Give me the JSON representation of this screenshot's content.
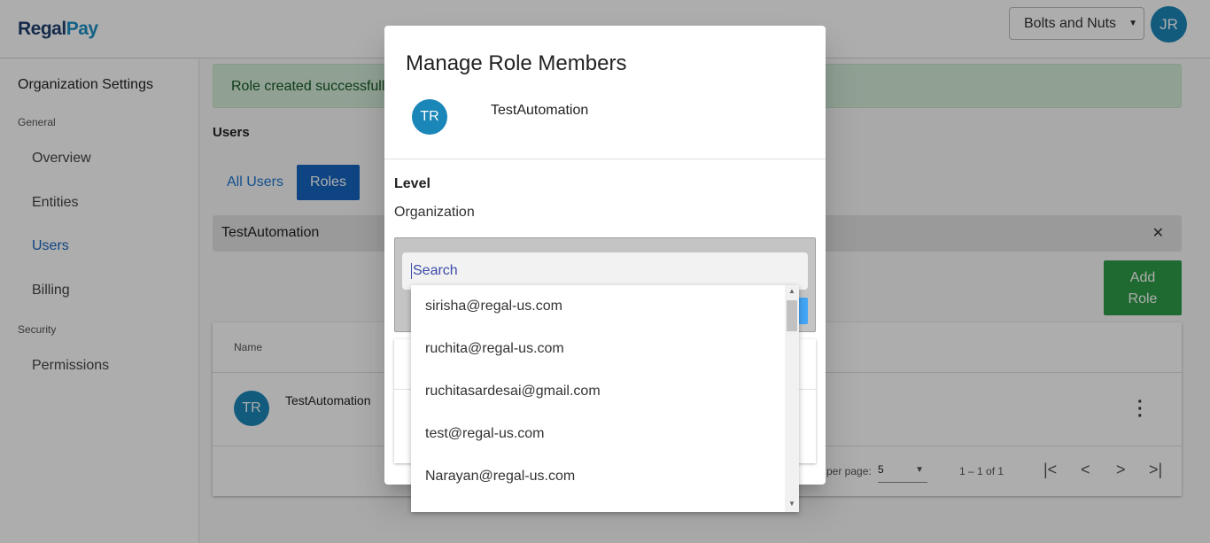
{
  "header": {
    "logo_part1": "Regal",
    "logo_part2": "Pay",
    "org_select": "Bolts and Nuts",
    "user_initials": "JR"
  },
  "sidebar": {
    "title": "Organization Settings",
    "sections": [
      {
        "label": "General",
        "items": [
          "Overview",
          "Entities",
          "Users",
          "Billing"
        ]
      },
      {
        "label": "Security",
        "items": [
          "Permissions"
        ]
      }
    ],
    "active_item": "Users"
  },
  "main": {
    "alert": "Role created successfully",
    "heading": "Users",
    "tabs": {
      "all_users": "All Users",
      "roles": "Roles"
    },
    "role_chip": "TestAutomation",
    "add_role_line1": "Add",
    "add_role_line2": "Role",
    "table": {
      "header_name": "Name",
      "rows": [
        {
          "initials": "TR",
          "name": "TestAutomation"
        }
      ]
    },
    "paginator": {
      "per_page_label": "per page:",
      "per_page_value": "5",
      "range": "1 – 1 of 1"
    }
  },
  "dialog": {
    "title": "Manage Role Members",
    "role_initials": "TR",
    "role_name": "TestAutomation",
    "level_label": "Level",
    "level_value": "Organization",
    "search_placeholder": "Search"
  },
  "dropdown": {
    "options": [
      "sirisha@regal-us.com",
      "ruchita@regal-us.com",
      "ruchitasardesai@gmail.com",
      "test@regal-us.com",
      "Narayan@regal-us.com"
    ]
  },
  "colors": {
    "primary": "#1565c0",
    "success": "#2e9c47",
    "avatar": "#1b86b8"
  }
}
